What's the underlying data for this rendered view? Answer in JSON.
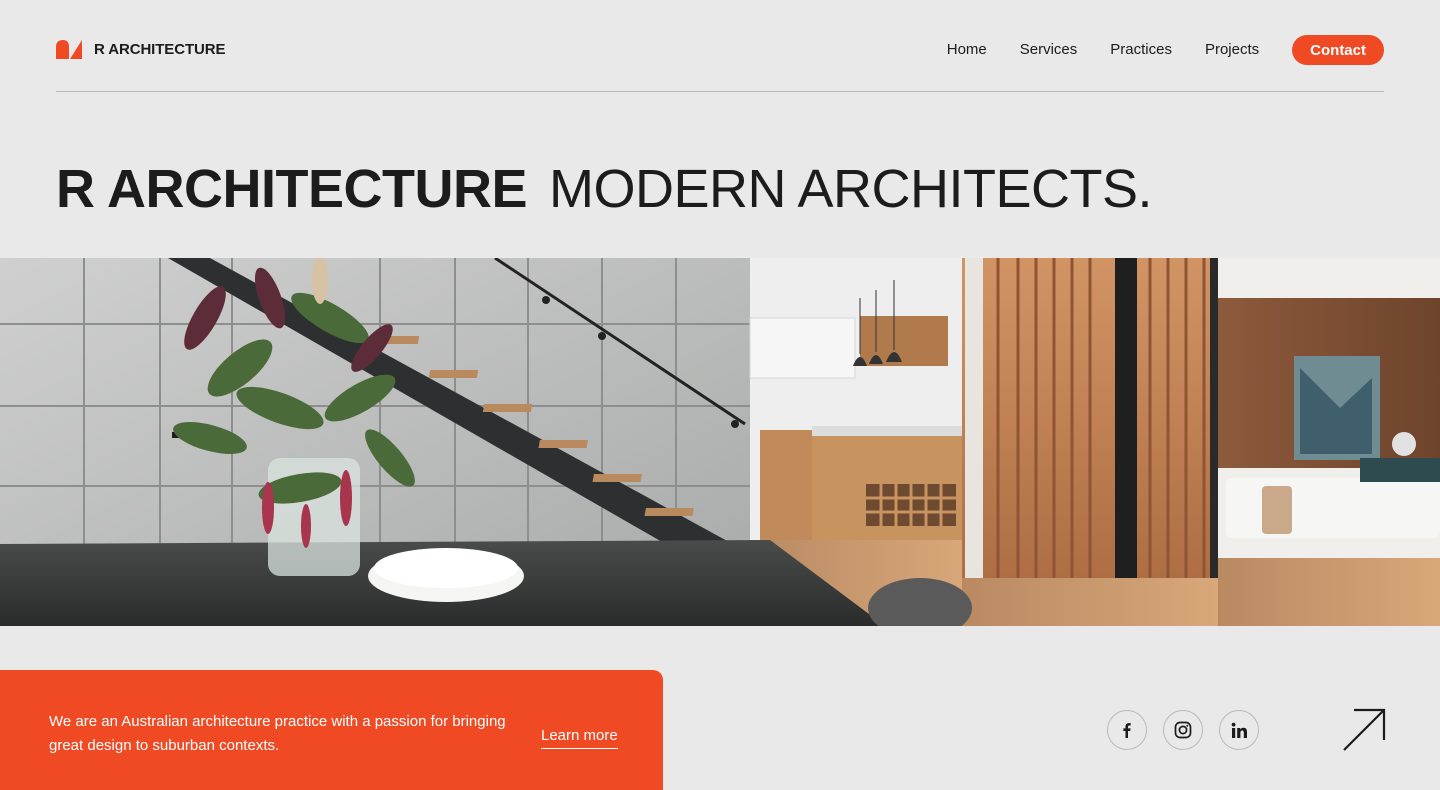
{
  "brand": {
    "name": "R ARCHITECTURE",
    "logo_icon": "brand-mark-icon",
    "accent_color": "#ef4a24"
  },
  "nav": {
    "links": [
      {
        "label": "Home"
      },
      {
        "label": "Services"
      },
      {
        "label": "Practices"
      },
      {
        "label": "Projects"
      }
    ],
    "contact_label": "Contact"
  },
  "hero": {
    "title_bold": "R ARCHITECTURE",
    "title_light": "MODERN ARCHITECTS."
  },
  "about": {
    "text": "We are an Australian architecture practice with a passion for bringing great design to suburban contexts.",
    "link_label": "Learn more"
  },
  "social": {
    "icons": [
      "facebook-icon",
      "instagram-icon",
      "linkedin-icon"
    ]
  },
  "cta": {
    "icon": "arrow-up-right-icon"
  }
}
